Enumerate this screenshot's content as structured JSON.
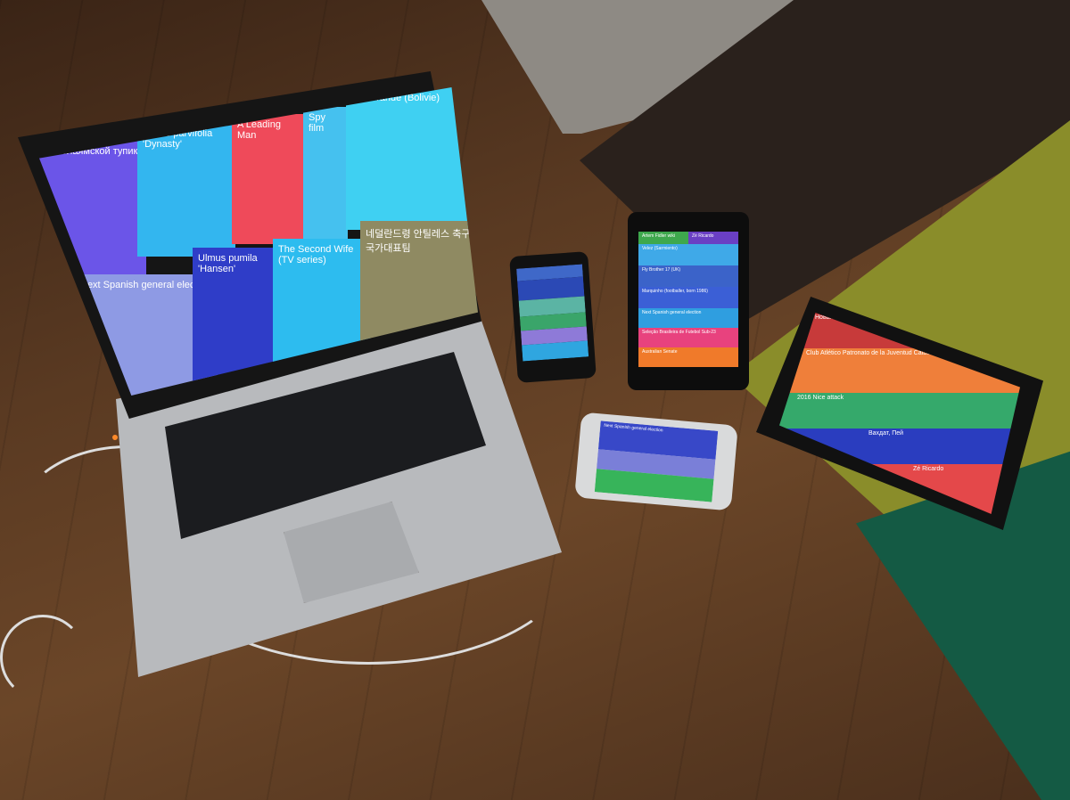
{
  "laptop": {
    "tiles": [
      {
        "title": "Николаямской тупик",
        "color": "#6b55e8"
      },
      {
        "title": "Ulmus parvifolia 'Dynasty'",
        "color": "#33b6ef"
      },
      {
        "title": "A Leading Man",
        "color": "#ef4a5a"
      },
      {
        "title": "Spy film",
        "color": "#45c1ef"
      },
      {
        "title": "Rio Grande (Bolivie)",
        "color": "#3fd0f2"
      },
      {
        "title": "Next Spanish general election",
        "color": "#8e9ae4"
      },
      {
        "title": "Ulmus pumila 'Hansen'",
        "color": "#2f3dc8"
      },
      {
        "title": "The Second Wife (TV series)",
        "color": "#2dbcef"
      },
      {
        "title": "네덜란드령 안틸레스 축구 국가대표팀",
        "color": "#8f8a62"
      }
    ]
  },
  "android_phone": {
    "rows": [
      {
        "label": "",
        "color": "#3f68c8"
      },
      {
        "label": "",
        "color": "#2b49b5"
      },
      {
        "label": "",
        "color": "#5bb4a4"
      },
      {
        "label": "",
        "color": "#3aa56a"
      },
      {
        "label": "",
        "color": "#8e7ad8"
      },
      {
        "label": "",
        "color": "#2fa6e0"
      }
    ]
  },
  "nexus7": {
    "header_left": "Artem Fidler wiki",
    "header_right": "Zé Ricardo",
    "rows": [
      {
        "label": "Velez (Sarmiento)",
        "color": "#3fa9e8"
      },
      {
        "label": "Fly Brother 17 (UK)",
        "color": "#3b63c9"
      },
      {
        "label": "Marquinho (footballer, born 1986)",
        "color": "#3b5fd6"
      },
      {
        "label": "Next Spanish general election",
        "color": "#2f9ee0"
      },
      {
        "label": "Seleção Brasileira de Futebol Sub-23",
        "color": "#e8427e"
      },
      {
        "label": "Australian Senate",
        "color": "#f07a2a"
      }
    ]
  },
  "iphone": {
    "rows": [
      {
        "label": "Next Spanish general election",
        "color": "#3848c8"
      },
      {
        "label": "",
        "color": "#7a7fd8"
      },
      {
        "label": "",
        "color": "#37b45a"
      }
    ]
  },
  "ipad": {
    "rows": [
      {
        "label": "Новая Башиловка",
        "color": "#c73a3a"
      },
      {
        "label": "Club Atlético Patronato de la Juventud Católica",
        "color": "#ef7f3a"
      },
      {
        "label": "2016 Nice attack",
        "color": "#35a96b"
      },
      {
        "label": "Вахдат, Пей",
        "color": "#2a3dbf"
      },
      {
        "label": "Zé Ricardo",
        "color": "#e4484a"
      }
    ]
  }
}
